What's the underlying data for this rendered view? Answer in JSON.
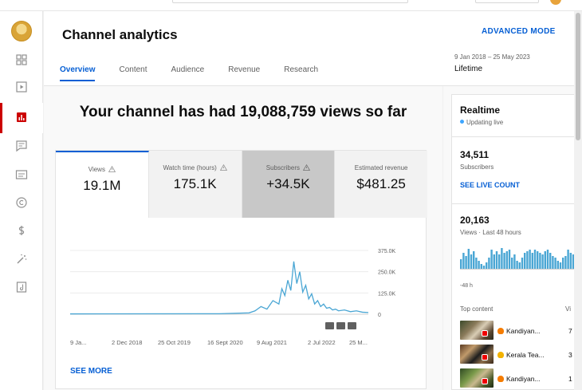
{
  "header": {
    "title": "Channel analytics",
    "advanced_mode": "ADVANCED MODE",
    "date_range": "9 Jan 2018 – 25 May 2023",
    "date_label": "Lifetime",
    "tabs": [
      {
        "label": "Overview",
        "active": true
      },
      {
        "label": "Content",
        "active": false
      },
      {
        "label": "Audience",
        "active": false
      },
      {
        "label": "Revenue",
        "active": false
      },
      {
        "label": "Research",
        "active": false
      }
    ]
  },
  "sidebar": {
    "items": [
      {
        "icon": "dashboard-icon"
      },
      {
        "icon": "content-icon"
      },
      {
        "icon": "analytics-icon",
        "active": true
      },
      {
        "icon": "comments-icon"
      },
      {
        "icon": "subtitles-icon"
      },
      {
        "icon": "copyright-icon"
      },
      {
        "icon": "earn-icon"
      },
      {
        "icon": "customisation-icon"
      },
      {
        "icon": "audio-library-icon"
      }
    ]
  },
  "main": {
    "headline": "Your channel has had 19,088,759 views so far",
    "metrics": [
      {
        "label": "Views",
        "value": "19.1M"
      },
      {
        "label": "Watch time (hours)",
        "value": "175.1K"
      },
      {
        "label": "Subscribers",
        "value": "+34.5K"
      },
      {
        "label": "Estimated revenue",
        "value": "$481.25"
      }
    ],
    "see_more": "SEE MORE"
  },
  "chart_data": {
    "type": "line",
    "x_tick_labels": [
      "9 Ja...",
      "2 Dec 2018",
      "25 Oct 2019",
      "16 Sept 2020",
      "9 Aug 2021",
      "2 Jul 2022",
      "25 M..."
    ],
    "y_tick_labels": [
      "375.0K",
      "250.0K",
      "125.0K",
      "0"
    ],
    "ylim": [
      0,
      375000
    ],
    "series": [
      {
        "x": [
          0,
          0.5,
          0.6,
          0.62,
          0.64,
          0.66,
          0.68,
          0.7,
          0.71,
          0.72,
          0.73,
          0.74,
          0.75,
          0.76,
          0.77,
          0.78,
          0.79,
          0.8,
          0.81,
          0.82,
          0.83,
          0.84,
          0.85,
          0.86,
          0.87,
          0.88,
          0.89,
          0.9,
          0.92,
          0.94,
          0.96,
          0.98,
          1.0
        ],
        "values": [
          2000,
          3000,
          8000,
          20000,
          45000,
          30000,
          80000,
          60000,
          150000,
          110000,
          200000,
          140000,
          310000,
          180000,
          250000,
          130000,
          170000,
          90000,
          120000,
          60000,
          80000,
          45000,
          60000,
          35000,
          40000,
          25000,
          30000,
          20000,
          25000,
          15000,
          20000,
          12000,
          10000
        ]
      }
    ],
    "color": "#4aa6d4",
    "grid": true,
    "chart_buttons": [
      "zoom-out",
      "zoom-in",
      "download"
    ]
  },
  "realtime": {
    "title": "Realtime",
    "status": "Updating live",
    "subscribers": "34,511",
    "subscribers_label": "Subscribers",
    "live_count": "SEE LIVE COUNT",
    "views": "20,163",
    "views_label": "Views · Last 48 hours",
    "bar_label": "-48 h",
    "bars": [
      12,
      20,
      16,
      25,
      18,
      22,
      14,
      10,
      6,
      4,
      8,
      14,
      24,
      18,
      22,
      18,
      26,
      20,
      22,
      24,
      14,
      18,
      10,
      8,
      14,
      20,
      22,
      24,
      20,
      24,
      22,
      20,
      18,
      22,
      24,
      20,
      16,
      14,
      10,
      8,
      14,
      16,
      24,
      20,
      18
    ],
    "top_content_label": "Top content",
    "top_content_col": "Vi",
    "top_items": [
      {
        "title": "Kandiyan...",
        "value": "7",
        "emoji_color": "#f57c00"
      },
      {
        "title": "Kerala Tea...",
        "value": "3",
        "emoji_color": "#f3b200"
      },
      {
        "title": "Kandiyan...",
        "value": "1",
        "emoji_color": "#f57c00"
      }
    ]
  },
  "colors": {
    "accent": "#065fd4",
    "active_nav": "#cc0000",
    "chart_line": "#4aa6d4"
  }
}
